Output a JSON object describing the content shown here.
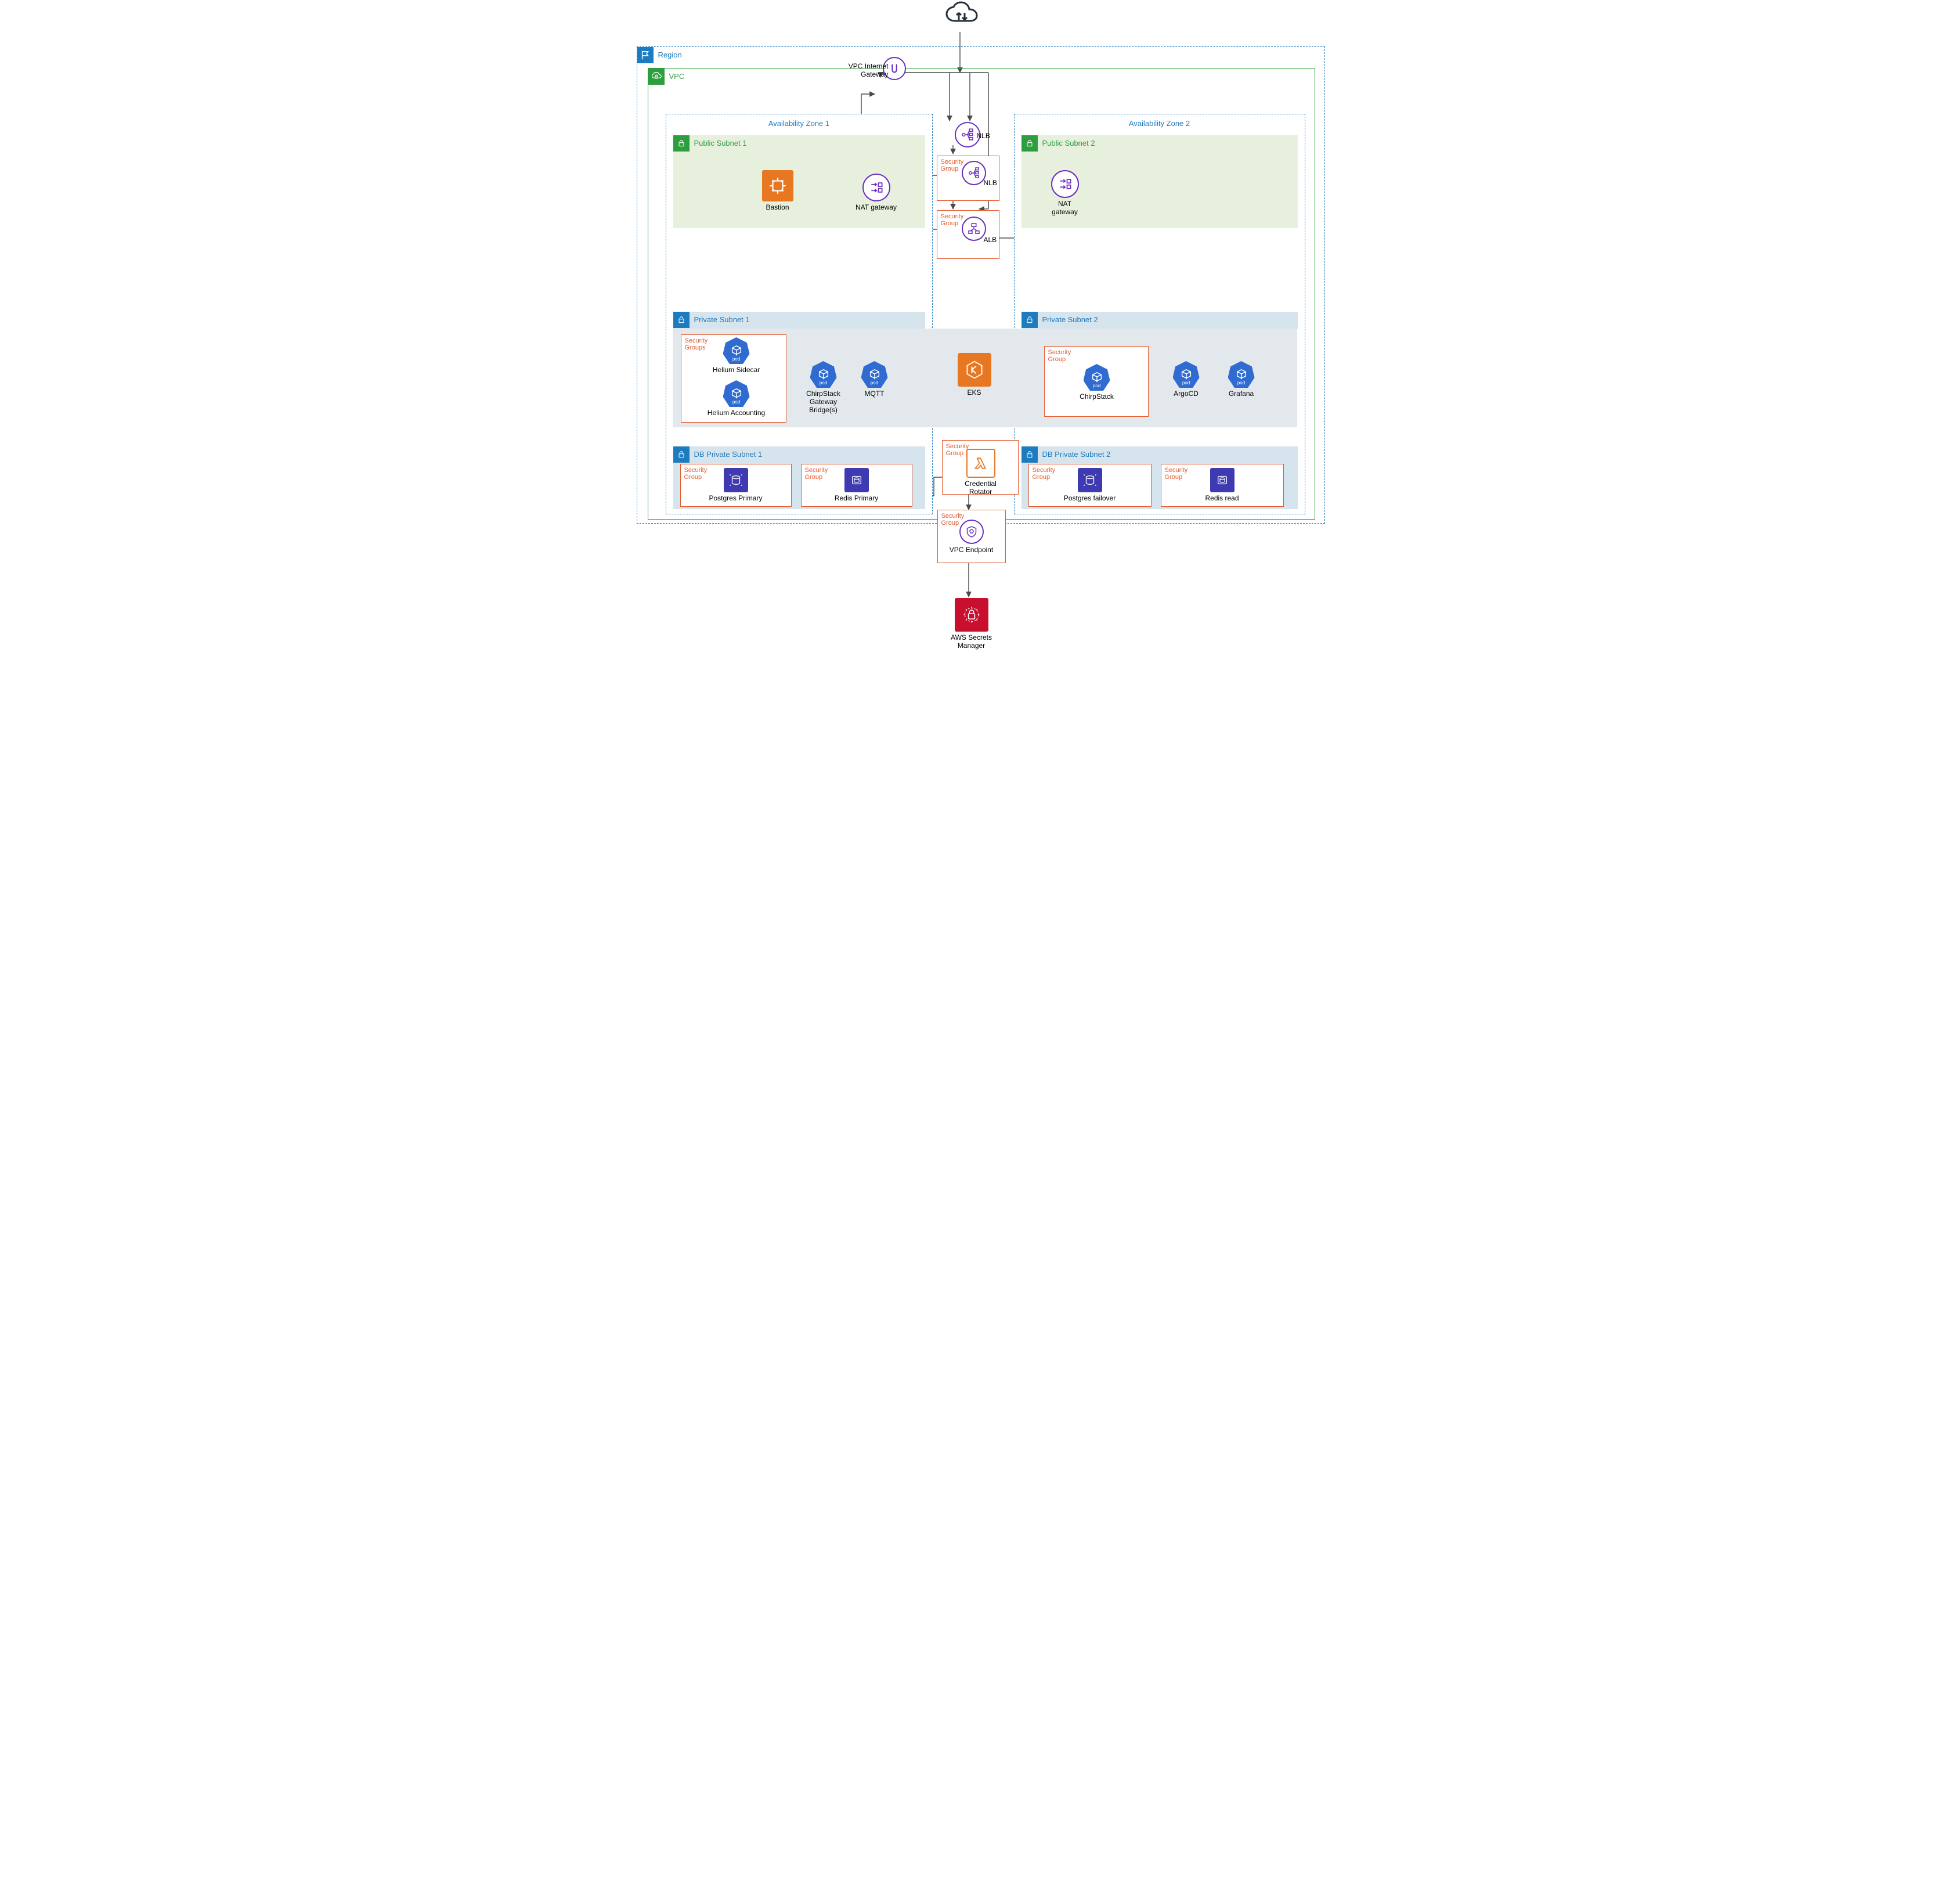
{
  "region": {
    "label": "Region"
  },
  "vpc": {
    "label": "VPC",
    "igw_label": "VPC Internet\nGateway"
  },
  "az1": {
    "label": "Availability Zone 1"
  },
  "az2": {
    "label": "Availability Zone 2"
  },
  "pub1": {
    "label": "Public Subnet 1",
    "bastion": "Bastion",
    "nat": "NAT gateway"
  },
  "pub2": {
    "label": "Public Subnet 2",
    "nat": "NAT\ngateway"
  },
  "priv1": {
    "label": "Private Subnet 1"
  },
  "priv2": {
    "label": "Private Subnet 2"
  },
  "db1": {
    "label": "DB Private Subnet 1"
  },
  "db2": {
    "label": "DB Private Subnet 2"
  },
  "sg_text_single": "Security\nGroup",
  "sg_text_plural": "Security\nGroups",
  "lb": {
    "top_nlb": "NLB",
    "sg_nlb": "NLB",
    "sg_alb": "ALB"
  },
  "eks": {
    "label": "EKS"
  },
  "pods": {
    "helium_sidecar": "Helium Sidecar",
    "helium_accounting": "Helium Accounting",
    "gw_bridge": "ChirpStack\nGateway\nBridge(s)",
    "mqtt": "MQTT",
    "chirpstack": "ChirpStack",
    "argocd": "ArgoCD",
    "grafana": "Grafana"
  },
  "db": {
    "pg_primary": "Postgres Primary",
    "redis_primary": "Redis Primary",
    "pg_failover": "Postgres failover",
    "redis_read": "Redis read"
  },
  "lambda": {
    "label": "Credential\nRotator"
  },
  "vpce": {
    "label": "VPC Endpoint"
  },
  "secrets": {
    "label": "AWS Secrets\nManager"
  }
}
